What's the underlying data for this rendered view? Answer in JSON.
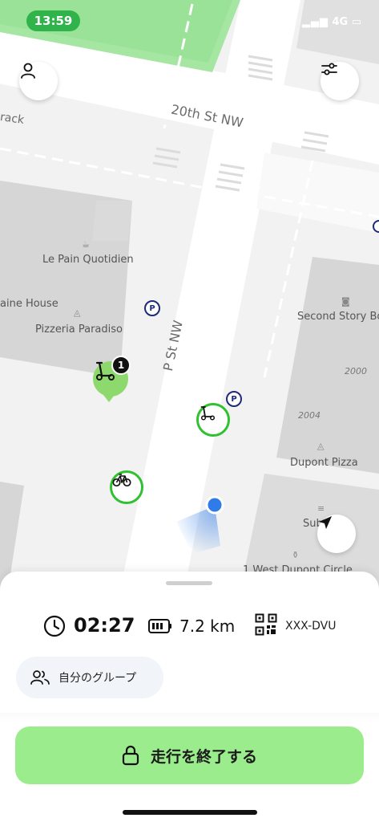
{
  "status": {
    "time": "13:59",
    "network": "4G"
  },
  "map": {
    "streets": {
      "top": "20th St NW",
      "vertical": "P St NW",
      "partial_left": "rack"
    },
    "pois": [
      "Le Pain Quotidien",
      "aine House",
      "Pizzeria Paradiso",
      "Second Story Bo",
      "Dupont Pizza",
      "Sub",
      "1 West Dupont Circle"
    ],
    "building_numbers": [
      "2000",
      "2004"
    ],
    "cluster_count": "1",
    "parking_symbol": "P"
  },
  "ride": {
    "time": "02:27",
    "distance": "7.2 km",
    "vehicle_code": "XXX-DVU",
    "group_label": "自分のグループ",
    "end_button_label": "走行を終了する"
  },
  "colors": {
    "accent_green": "#9bec8c",
    "marker_green": "#2fc12f",
    "location_blue": "#2f7be8"
  }
}
